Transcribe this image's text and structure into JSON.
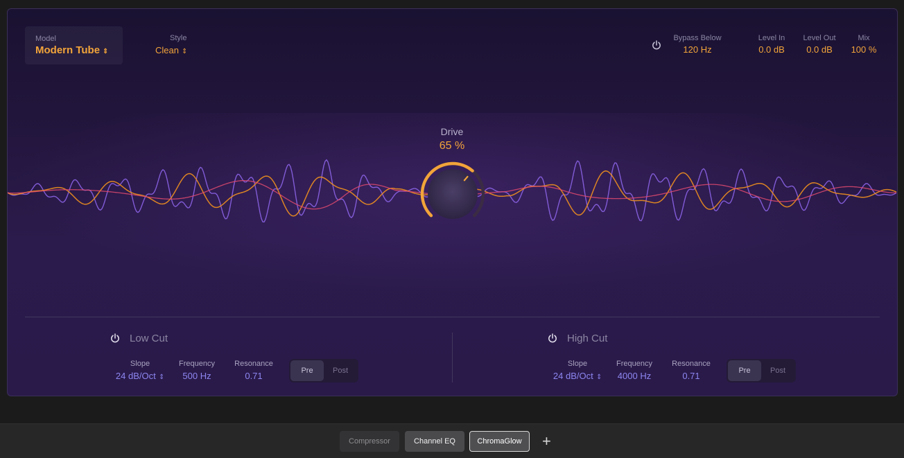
{
  "header": {
    "model_label": "Model",
    "model_value": "Modern Tube",
    "style_label": "Style",
    "style_value": "Clean",
    "bypass_label": "Bypass Below",
    "bypass_value": "120 Hz",
    "level_in_label": "Level In",
    "level_in_value": "0.0 dB",
    "level_out_label": "Level Out",
    "level_out_value": "0.0 dB",
    "mix_label": "Mix",
    "mix_value": "100 %"
  },
  "drive": {
    "label": "Drive",
    "value_text": "65 %",
    "value": 0.65
  },
  "low_cut": {
    "title": "Low Cut",
    "slope_label": "Slope",
    "slope_value": "24 dB/Oct",
    "frequency_label": "Frequency",
    "frequency_value": "500 Hz",
    "resonance_label": "Resonance",
    "resonance_value": "0.71",
    "pre": "Pre",
    "post": "Post",
    "selected": "Pre"
  },
  "high_cut": {
    "title": "High Cut",
    "slope_label": "Slope",
    "slope_value": "24 dB/Oct",
    "frequency_label": "Frequency",
    "frequency_value": "4000 Hz",
    "resonance_label": "Resonance",
    "resonance_value": "0.71",
    "pre": "Pre",
    "post": "Post",
    "selected": "Pre"
  },
  "footer": {
    "tabs": [
      "Compressor",
      "Channel EQ",
      "ChromaGlow"
    ],
    "active_tab": "ChromaGlow",
    "add_symbol": "+"
  },
  "colors": {
    "accent": "#f2a43a",
    "value_blue": "#8d86f0",
    "wave_purple": "#8b63e6",
    "wave_orange": "#f0901e",
    "wave_pink": "#e04a6e"
  },
  "icons": {
    "power": "power-icon",
    "updown": "chevron-updown-icon",
    "add": "plus-icon"
  }
}
